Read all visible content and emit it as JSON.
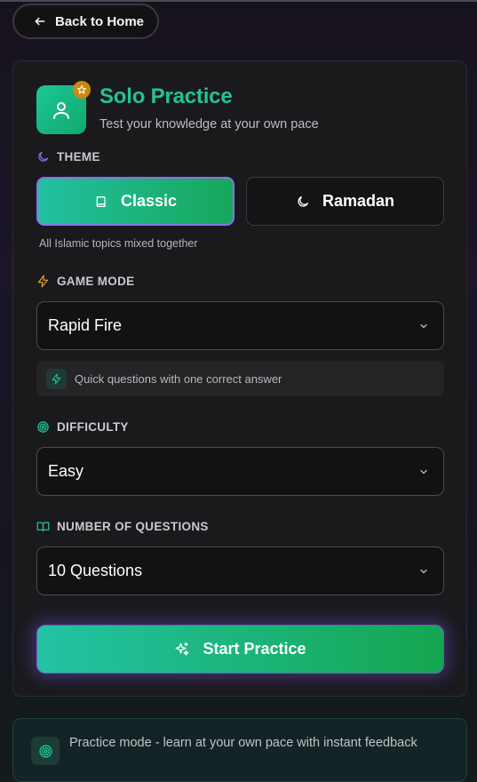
{
  "nav": {
    "back_label": "Back to Home"
  },
  "header": {
    "title": "Solo Practice",
    "subtitle": "Test your knowledge at your own pace"
  },
  "theme": {
    "label": "THEME",
    "options": [
      {
        "label": "Classic",
        "selected": true
      },
      {
        "label": "Ramadan",
        "selected": false
      }
    ],
    "description": "All Islamic topics mixed together"
  },
  "game_mode": {
    "label": "GAME MODE",
    "selected": "Rapid Fire",
    "hint": "Quick questions with one correct answer"
  },
  "difficulty": {
    "label": "DIFFICULTY",
    "selected": "Easy"
  },
  "questions": {
    "label": "NUMBER OF QUESTIONS",
    "selected": "10 Questions"
  },
  "start": {
    "label": "Start Practice"
  },
  "info": {
    "text": "Practice mode - learn at your own pace with instant feedback"
  },
  "colors": {
    "accent_green": "#25c295",
    "accent_purple": "#8d6ff0",
    "badge_gold": "#c98a0f",
    "bolt_orange": "#e39a2c"
  },
  "icons": {
    "back": "arrow-left-icon",
    "logo": "user-icon",
    "badge": "star-icon",
    "theme": "moon-icon",
    "classic": "book-icon",
    "ramadan": "moon-icon",
    "game_mode": "lightning-icon",
    "difficulty": "target-icon",
    "questions": "open-book-icon",
    "start": "sparkles-icon",
    "info": "target-icon"
  }
}
